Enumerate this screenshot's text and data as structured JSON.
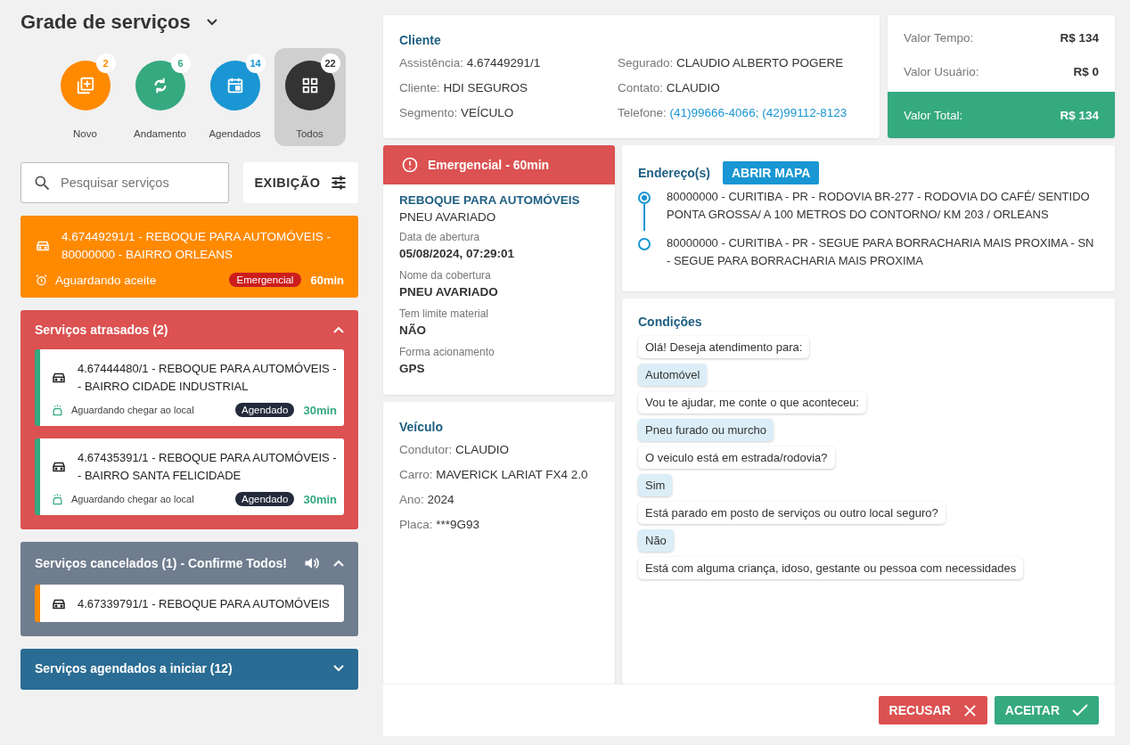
{
  "title": "Grade de serviços",
  "filters": [
    {
      "label": "Novo",
      "count": "2",
      "kind": "novo",
      "color": "#ff8a00",
      "selected": false
    },
    {
      "label": "Andamento",
      "count": "6",
      "kind": "andamento",
      "color": "#35a97f",
      "selected": false
    },
    {
      "label": "Agendados",
      "count": "14",
      "kind": "agendados",
      "color": "#1996d3",
      "selected": false
    },
    {
      "label": "Todos",
      "count": "22",
      "kind": "todos",
      "color": "#333333",
      "selected": true
    }
  ],
  "search": {
    "placeholder": "Pesquisar serviços"
  },
  "display_button": "EXIBIÇÃO",
  "current_service": {
    "text": "4.67449291/1 - REBOQUE PARA AUTOMÓVEIS - 80000000 - BAIRRO ORLEANS",
    "status": "Aguardando aceite",
    "badge": "Emergencial",
    "time": "60min"
  },
  "sections": [
    {
      "title": "Serviços atrasados (2)",
      "color": "#dc5151",
      "expanded": true,
      "sound": false,
      "items": [
        {
          "text": "4.67444480/1 - REBOQUE PARA AUTOMÓVEIS - - BAIRRO CIDADE INDUSTRIAL",
          "status": "Aguardando chegar ao local",
          "badge": "Agendado",
          "time": "30min",
          "color": "#35a97f"
        },
        {
          "text": "4.67435391/1 - REBOQUE PARA AUTOMÓVEIS - - BAIRRO SANTA FELICIDADE",
          "status": "Aguardando chegar ao local",
          "badge": "Agendado",
          "time": "30min",
          "color": "#35a97f"
        }
      ]
    },
    {
      "title": "Serviços cancelados (1) - Confirme Todos!",
      "color": "#6f7d8f",
      "expanded": true,
      "sound": true,
      "items": [
        {
          "text": "4.67339791/1 - REBOQUE PARA AUTOMÓVEIS",
          "color": "#ff8a00"
        }
      ]
    },
    {
      "title": "Serviços agendados a iniciar (12)",
      "color": "#2a6c93",
      "expanded": false,
      "sound": false
    }
  ],
  "client": {
    "title": "Cliente",
    "fields": [
      {
        "label": "Assistência:",
        "value": "4.67449291/1"
      },
      {
        "label": "Segurado:",
        "value": "CLAUDIO ALBERTO POGERE"
      },
      {
        "label": "Cliente:",
        "value": "HDI SEGUROS"
      },
      {
        "label": "Contato:",
        "value": "CLAUDIO"
      },
      {
        "label": "Segmento:",
        "value": "VEÍCULO"
      },
      {
        "label": "Telefone:",
        "value": "(41)99666-4066; (42)99112-8123",
        "kind": "link"
      }
    ]
  },
  "values": [
    {
      "label": "Valor Tempo:",
      "value": "R$ 134",
      "total": false
    },
    {
      "label": "Valor Usuário:",
      "value": "R$ 0",
      "total": false
    },
    {
      "label": "Valor Total:",
      "value": "R$ 134",
      "total": true
    }
  ],
  "service": {
    "banner": "Emergencial - 60min",
    "title": "REBOQUE PARA AUTOMÓVEIS",
    "subtitle": "PNEU AVARIADO",
    "fields": [
      {
        "label": "Data de abertura",
        "value": "05/08/2024, 07:29:01"
      },
      {
        "label": "Nome da cobertura",
        "value": "PNEU AVARIADO"
      },
      {
        "label": "Tem limite material",
        "value": "NÃO"
      },
      {
        "label": "Forma acionamento",
        "value": "GPS"
      }
    ]
  },
  "vehicle": {
    "title": "Veículo",
    "fields": [
      {
        "label": "Condutor:",
        "value": "CLAUDIO"
      },
      {
        "label": "Carro:",
        "value": "MAVERICK LARIAT FX4 2.0"
      },
      {
        "label": "Ano:",
        "value": "2024"
      },
      {
        "label": "Placa:",
        "value": "***9G93"
      }
    ]
  },
  "addresses": {
    "title": "Endereço(s)",
    "map_button": "ABRIR MAPA",
    "items": [
      "80000000 - CURITIBA - PR - RODOVIA BR-277 - RODOVIA DO CAFÉ/ SENTIDO PONTA GROSSA/ A 100 METROS DO CONTORNO/ KM 203 / ORLEANS",
      "80000000 - CURITIBA - PR - SEGUE PARA BORRACHARIA MAIS PROXIMA - SN - SEGUE PARA BORRACHARIA MAIS PROXIMA"
    ]
  },
  "conditions": {
    "title": "Condições",
    "messages": [
      {
        "kind": "question",
        "text": "Olá! Deseja atendimento para:"
      },
      {
        "kind": "answer",
        "text": "Automóvel"
      },
      {
        "kind": "question",
        "text": "Vou te ajudar, me conte o que aconteceu:"
      },
      {
        "kind": "answer",
        "text": "Pneu furado ou murcho"
      },
      {
        "kind": "question",
        "text": "O veiculo está em estrada/rodovia?"
      },
      {
        "kind": "answer",
        "text": "Sim"
      },
      {
        "kind": "question",
        "text": "Está parado em posto de serviços ou outro local seguro?"
      },
      {
        "kind": "answer",
        "text": "Não"
      },
      {
        "kind": "question",
        "text": "Está com alguma criança, idoso, gestante ou pessoa com necessidades"
      }
    ]
  },
  "actions": [
    {
      "label": "RECUSAR",
      "kind": "reject"
    },
    {
      "label": "ACEITAR",
      "kind": "accept"
    }
  ]
}
